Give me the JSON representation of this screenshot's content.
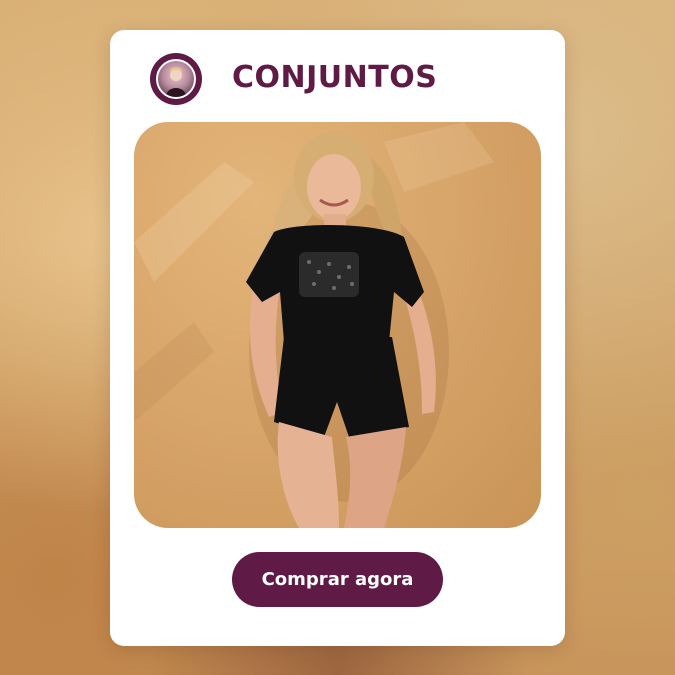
{
  "card": {
    "title": "CONJUNTOS",
    "logo_icon": "brand-logo-icon",
    "product_image_alt": "model-in-black-romper"
  },
  "cta": {
    "label": "Comprar agora"
  },
  "colors": {
    "brand": "#5f1a45",
    "card_bg": "#ffffff",
    "photo_bg": "#d8a76a",
    "backdrop": "#cfa066"
  }
}
